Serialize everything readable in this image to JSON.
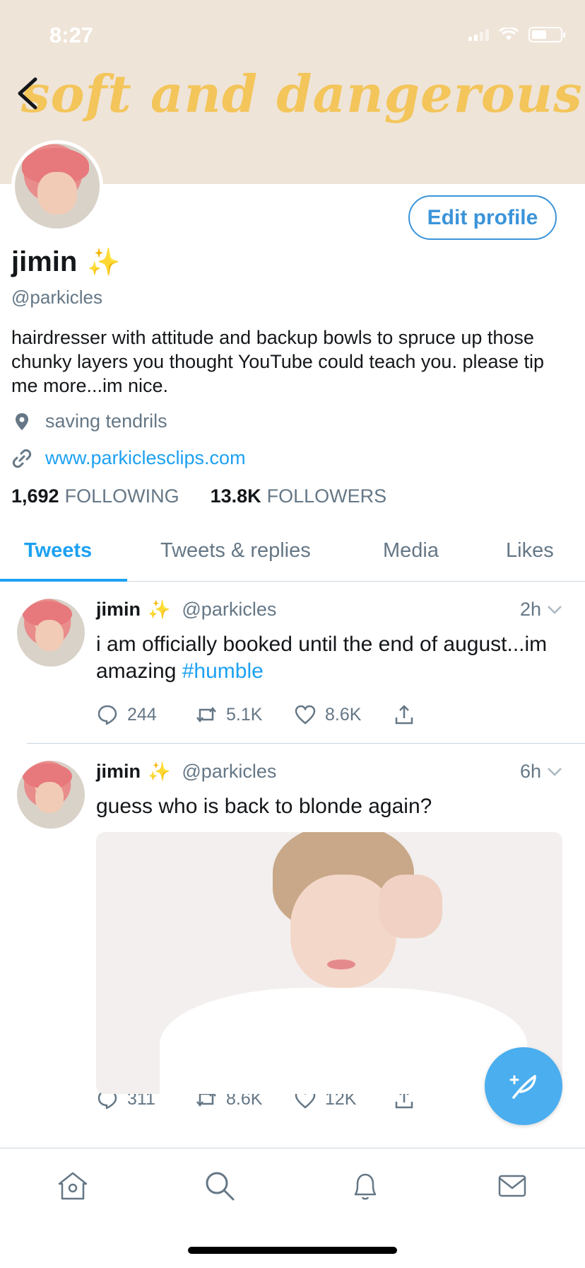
{
  "status_bar": {
    "time": "8:27"
  },
  "banner": {
    "text": "soft and dangerous."
  },
  "profile": {
    "edit_button": "Edit profile",
    "name": "jimin",
    "name_emoji": "✨",
    "handle": "@parkicles",
    "bio": "hairdresser with attitude and backup bowls to spruce up those chunky layers you thought YouTube could teach you. please tip me more...im nice.",
    "location": "saving tendrils",
    "website": "www.parkiclesclips.com",
    "following_count": "1,692",
    "following_label": "FOLLOWING",
    "followers_count": "13.8K",
    "followers_label": "FOLLOWERS"
  },
  "tabs": [
    "Tweets",
    "Tweets & replies",
    "Media",
    "Likes"
  ],
  "tweets": [
    {
      "name": "jimin",
      "emoji": "✨",
      "handle": "@parkicles",
      "time": "2h",
      "text": "i am officially booked until the end of august...im amazing ",
      "hashtag": "#humble",
      "replies": "244",
      "retweets": "5.1K",
      "likes": "8.6K"
    },
    {
      "name": "jimin",
      "emoji": "✨",
      "handle": "@parkicles",
      "time": "6h",
      "text": "guess who is back to blonde again?",
      "replies": "311",
      "retweets": "8.6K",
      "likes": "12K"
    }
  ],
  "colors": {
    "accent": "#1da1f2",
    "banner_bg": "#efe4d8",
    "banner_text": "#f3c55a",
    "muted": "#657786"
  }
}
